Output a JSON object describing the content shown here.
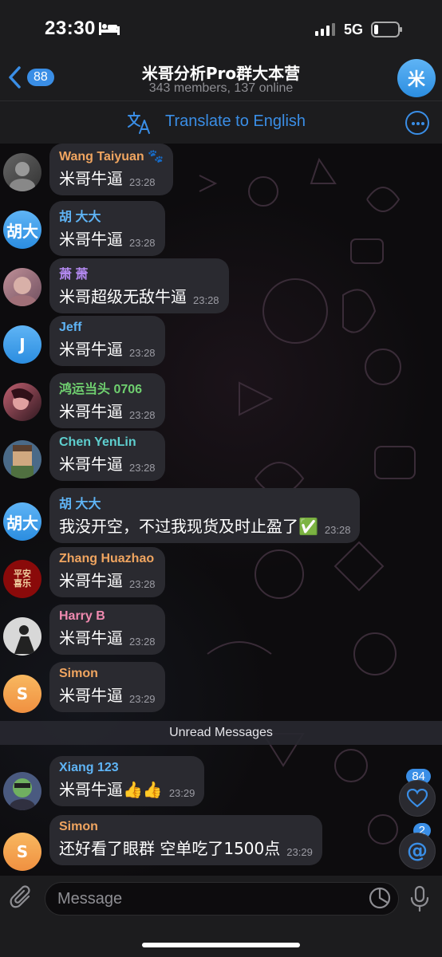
{
  "status_bar": {
    "time": "23:30",
    "network": "5G"
  },
  "header": {
    "back_count": "88",
    "title": "米哥分析Pro群大本营",
    "subtitle": "343 members, 137 online",
    "avatar_letter": "米"
  },
  "translate": {
    "label": "Translate to English"
  },
  "messages": [
    {
      "sender": "Wang Taiyuan 🐾",
      "text": "米哥牛逼",
      "time": "23:28",
      "color": "#f0a560",
      "avatar_text": "",
      "avatar_color": "#555"
    },
    {
      "sender": "胡 大大",
      "text": "米哥牛逼",
      "time": "23:28",
      "color": "#5fb4f5",
      "avatar_text": "胡大",
      "avatar_color": "#3a8ee6"
    },
    {
      "sender": "萧 萧",
      "text": "米哥超级无敌牛逼",
      "time": "23:28",
      "color": "#b389f0",
      "avatar_text": "",
      "avatar_color": "#a07080"
    },
    {
      "sender": "Jeff",
      "text": "米哥牛逼",
      "time": "23:28",
      "color": "#5fb4f5",
      "avatar_text": "J",
      "avatar_color": "#3a8ee6"
    },
    {
      "sender": "鸿运当头 0706",
      "text": "米哥牛逼",
      "time": "23:28",
      "color": "#6fcf6f",
      "avatar_text": "",
      "avatar_color": "#5a3040"
    },
    {
      "sender": "Chen YenLin",
      "text": "米哥牛逼",
      "time": "23:28",
      "color": "#5ecfcf",
      "avatar_text": "",
      "avatar_color": "#6a8aa0"
    },
    {
      "sender": "胡 大大",
      "text": "我没开空，不过我现货及时止盈了✅",
      "time": "23:28",
      "color": "#5fb4f5",
      "avatar_text": "胡大",
      "avatar_color": "#3a8ee6"
    },
    {
      "sender": "Zhang Huazhao",
      "text": "米哥牛逼",
      "time": "23:28",
      "color": "#f0a560",
      "avatar_text": "平安喜乐",
      "avatar_color": "#8a0a0a"
    },
    {
      "sender": "Harry B",
      "text": "米哥牛逼",
      "time": "23:28",
      "color": "#f08ab0",
      "avatar_text": "",
      "avatar_color": "#333"
    },
    {
      "sender": "Simon",
      "text": "米哥牛逼",
      "time": "23:29",
      "color": "#f0a560",
      "avatar_text": "S",
      "avatar_color": "#f0a050"
    },
    {
      "sender": "Xiang 123",
      "text": "米哥牛逼👍👍",
      "time": "23:29",
      "color": "#5fb4f5",
      "avatar_text": "",
      "avatar_color": "#4a5a80"
    },
    {
      "sender": "Simon",
      "text": "还好看了眼群 空单吃了1500点",
      "time": "23:29",
      "color": "#f0a560",
      "avatar_text": "S",
      "avatar_color": "#f0a050"
    }
  ],
  "unread": {
    "label": "Unread Messages"
  },
  "reactions_badge": "84",
  "mentions_badge": "2",
  "input": {
    "placeholder": "Message"
  },
  "icons": [
    "bed-icon",
    "signal-icon",
    "battery-icon",
    "chevron-left-icon",
    "translate-icon",
    "more-icon",
    "heart-icon",
    "at-icon",
    "paperclip-icon",
    "sticker-icon",
    "microphone-icon"
  ],
  "colors": {
    "accent": "#3a8ee6",
    "bubble": "#2a2a30",
    "background": "#0d0c0e"
  }
}
